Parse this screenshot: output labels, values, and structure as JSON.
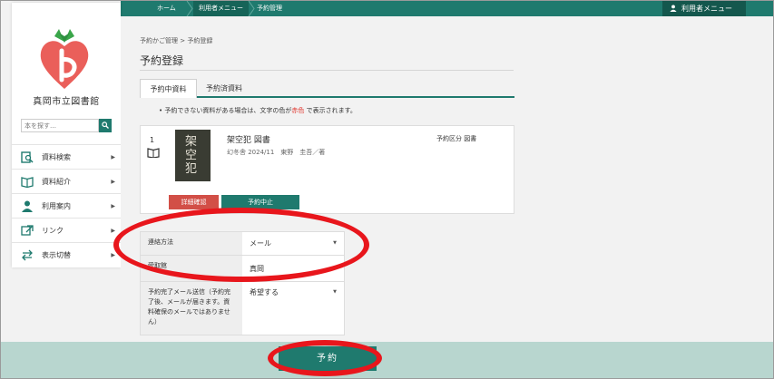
{
  "topbar": {
    "breadcrumb": [
      "ホーム",
      "利用者メニュー",
      "予約管理"
    ],
    "user_menu": "利用者メニュー",
    "user_icon": "person-icon"
  },
  "sidebar": {
    "library_name": "真岡市立図書館",
    "search_placeholder": "本を探す…",
    "search_icon": "search-icon",
    "items": [
      {
        "label": "資料検索",
        "icon": "search-doc-icon"
      },
      {
        "label": "資料紹介",
        "icon": "open-book-icon"
      },
      {
        "label": "利用案内",
        "icon": "person-icon"
      },
      {
        "label": "リンク",
        "icon": "link-icon"
      },
      {
        "label": "表示切替",
        "icon": "switch-arrows-icon"
      }
    ]
  },
  "main": {
    "breadcrumb": "予約かご管理 > 予約登録",
    "title": "予約登録",
    "tabs": [
      {
        "label": "予約中資料",
        "active": true
      },
      {
        "label": "予約済資料",
        "active": false
      }
    ],
    "notice_before": "予約できない資料がある場合は、文字の色が",
    "notice_red": "赤色",
    "notice_after": "で表示されます。",
    "item": {
      "number": "1",
      "title": "架空犯 図書",
      "meta": "幻冬舎 2024/11　東野　圭吾／著",
      "kubun": "予約区分 図書",
      "cover_text": "架空犯",
      "detail_button": "詳細確認",
      "cancel_button": "予約中止"
    },
    "form": {
      "contact_label": "連絡方法",
      "contact_value": "メール",
      "pickup_label": "受取館",
      "pickup_value": "真岡",
      "mail_label": "予約完了メール送信（予約完了後、メールが届きます。資料確保のメールではありません）",
      "mail_value": "希望する"
    },
    "submit_label": "予約"
  },
  "colors": {
    "accent": "#1f7a6e",
    "danger": "#d24f47",
    "highlight": "#e8161c"
  }
}
